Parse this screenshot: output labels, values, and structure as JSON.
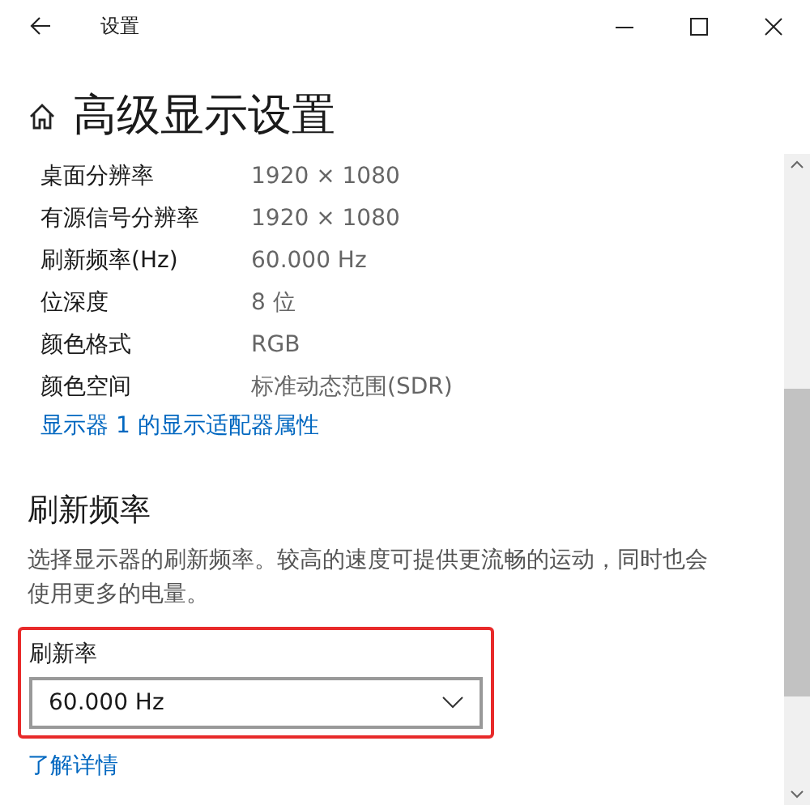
{
  "window": {
    "title": "设置"
  },
  "page": {
    "title": "高级显示设置"
  },
  "display_info": [
    {
      "label": "桌面分辨率",
      "value": "1920 × 1080"
    },
    {
      "label": "有源信号分辨率",
      "value": "1920 × 1080"
    },
    {
      "label": "刷新频率(Hz)",
      "value": "60.000 Hz"
    },
    {
      "label": "位深度",
      "value": "8 位"
    },
    {
      "label": "颜色格式",
      "value": "RGB"
    },
    {
      "label": "颜色空间",
      "value": "标准动态范围(SDR)"
    }
  ],
  "adapter_link": "显示器 1 的显示适配器属性",
  "refresh_section": {
    "heading": "刷新频率",
    "description": "选择显示器的刷新频率。较高的速度可提供更流畅的运动，同时也会使用更多的电量。",
    "field_label": "刷新率",
    "value": "60.000 Hz",
    "highlighted": true,
    "learn_more": "了解详情"
  }
}
